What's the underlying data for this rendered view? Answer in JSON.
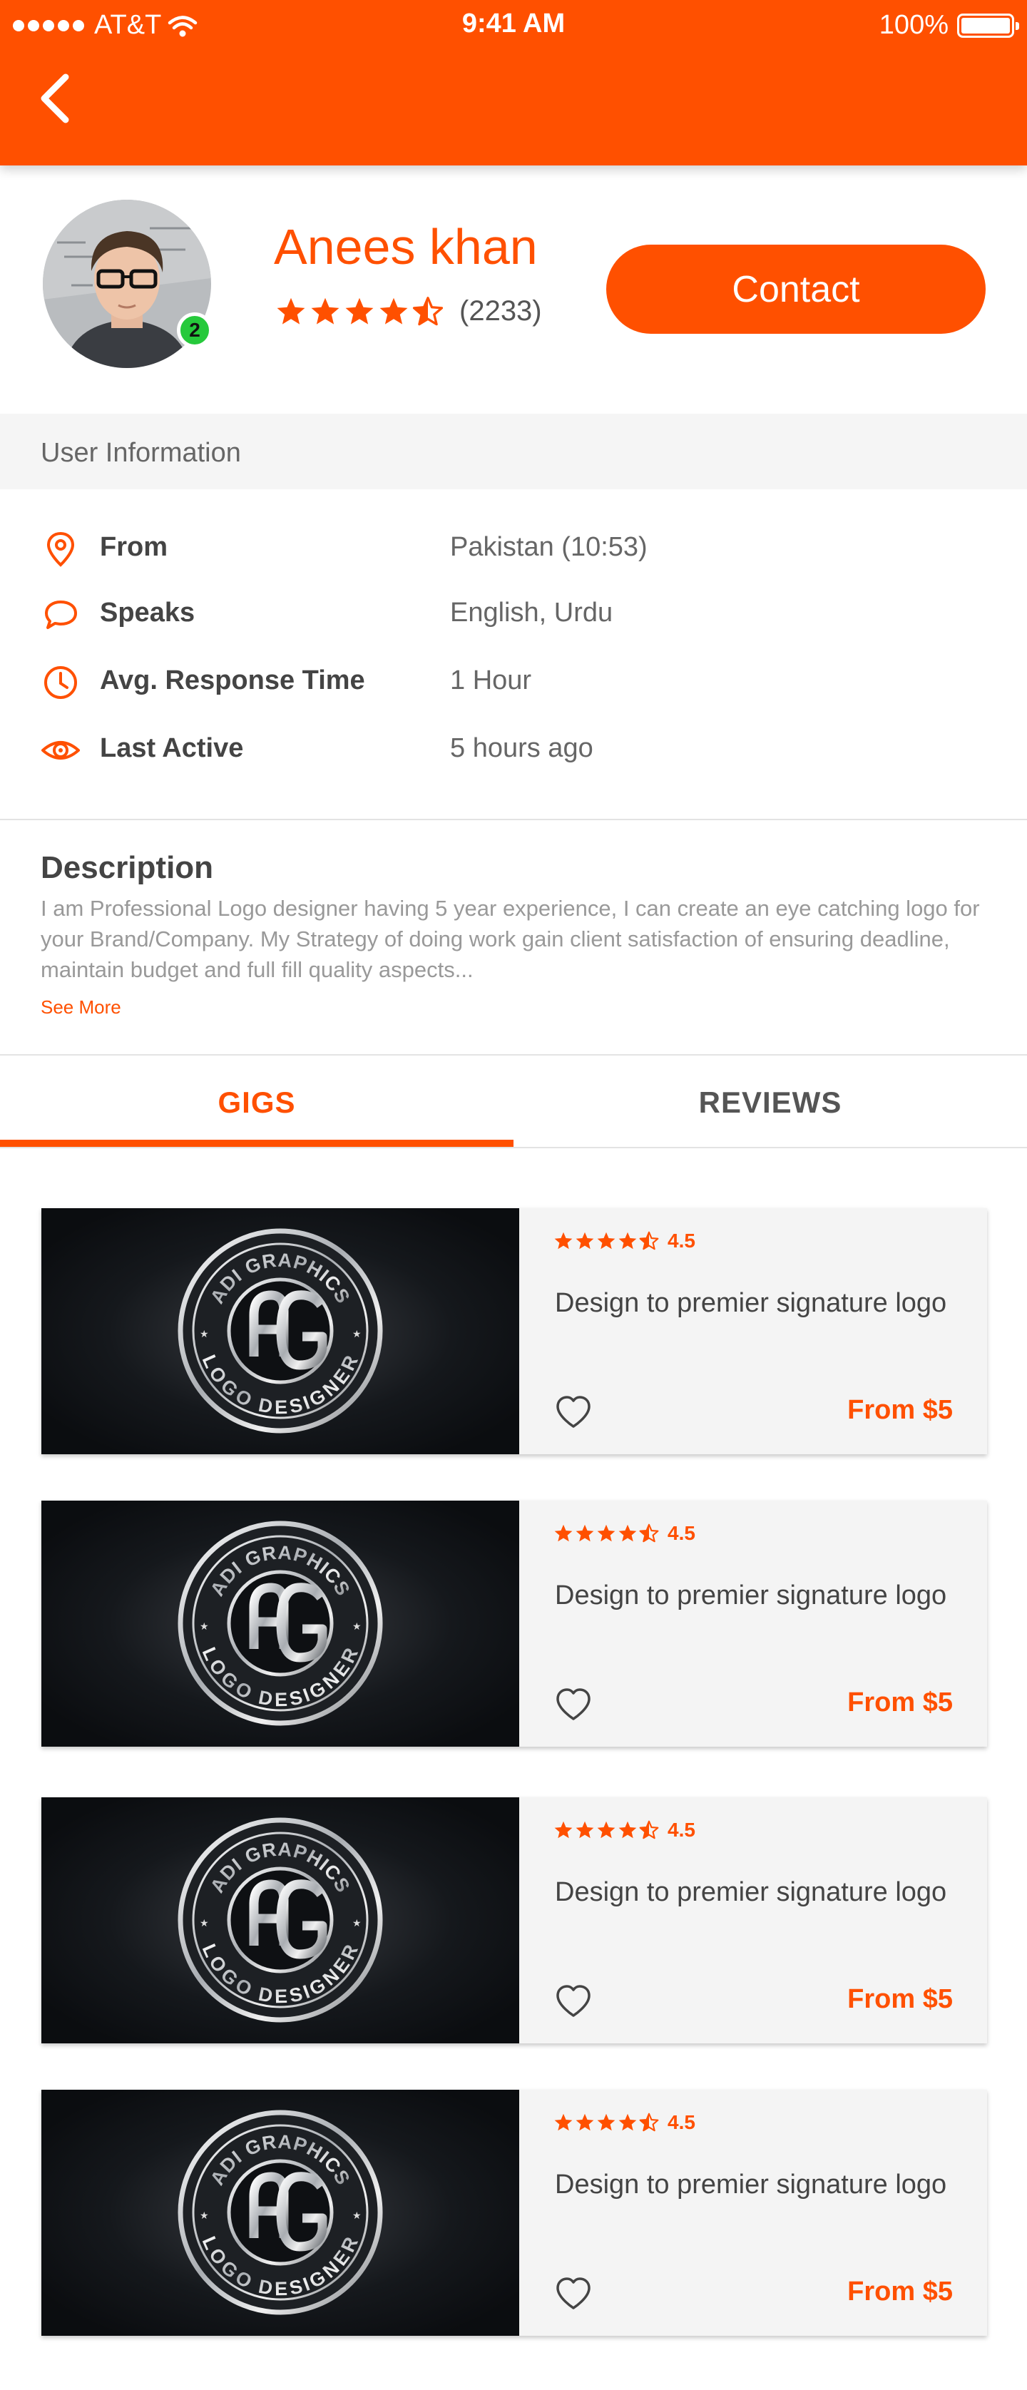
{
  "status_bar": {
    "carrier": "AT&T",
    "time": "9:41 AM",
    "battery": "100%"
  },
  "profile": {
    "name": "Anees khan",
    "rating_count": "(2233)",
    "rating_stars": 4.5,
    "badge_count": "2",
    "contact_label": "Contact",
    "online_color": "#26c93b"
  },
  "theme": {
    "accent": "#ff5000"
  },
  "user_info": {
    "section_title": "User Information",
    "rows": [
      {
        "icon": "location-pin-icon",
        "label": "From",
        "value": "Pakistan (10:53)"
      },
      {
        "icon": "speech-bubble-icon",
        "label": "Speaks",
        "value": "English, Urdu"
      },
      {
        "icon": "clock-icon",
        "label": "Avg. Response Time",
        "value": "1 Hour"
      },
      {
        "icon": "eye-icon",
        "label": "Last Active",
        "value": "5 hours ago"
      }
    ]
  },
  "description": {
    "title": "Description",
    "text": "I am Professional Logo designer having 5 year experience, I can create an eye catching logo for your Brand/Company. My Strategy of doing work gain client satisfaction of ensuring deadline, maintain budget and full fill quality aspects...",
    "see_more": "See More"
  },
  "tabs": [
    {
      "label": "GIGS",
      "active": true
    },
    {
      "label": "REVIEWS",
      "active": false
    }
  ],
  "gig_logo": {
    "top_text": "ADI GRAPHICS",
    "bottom_text": "LOGO DESIGNER"
  },
  "gigs": [
    {
      "rating": "4.5",
      "title": "Design to premier signature logo",
      "price": "From $5"
    },
    {
      "rating": "4.5",
      "title": "Design to premier signature logo",
      "price": "From $5"
    },
    {
      "rating": "4.5",
      "title": "Design to premier signature logo",
      "price": "From $5"
    },
    {
      "rating": "4.5",
      "title": "Design to premier signature logo",
      "price": "From $5"
    }
  ]
}
